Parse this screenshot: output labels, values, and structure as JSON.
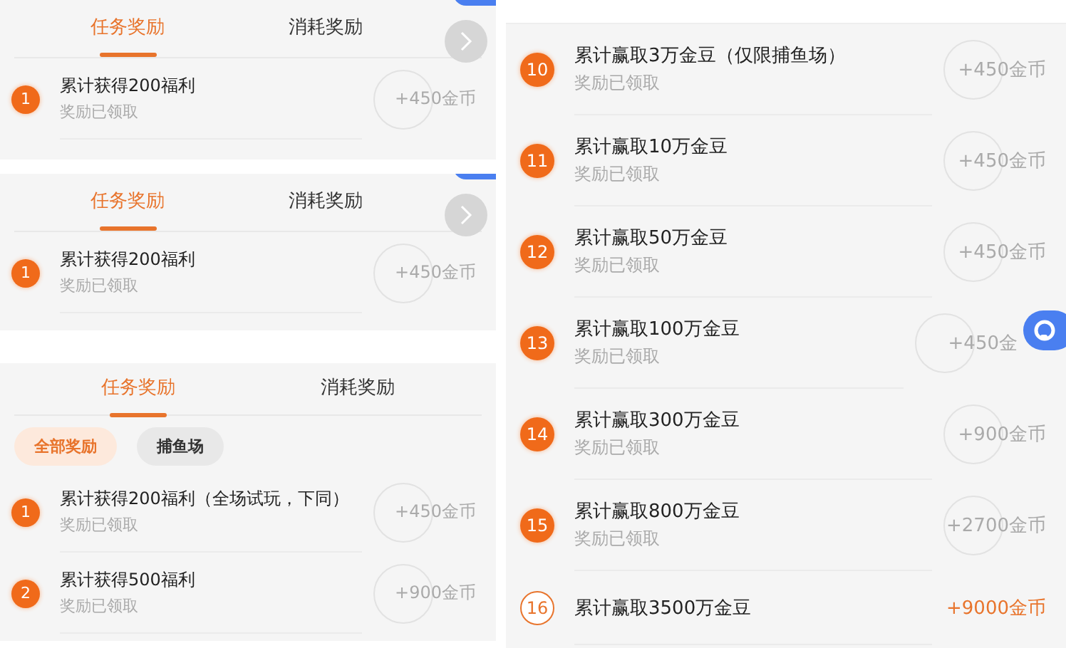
{
  "panels": [
    {
      "arrow_button": true,
      "tabs": [
        {
          "label": "任务奖励",
          "selected": true
        },
        {
          "label": "消耗奖励",
          "selected": false
        }
      ],
      "tasks": [
        {
          "number": "1",
          "title": "累计获得200福利",
          "status": "奖励已领取",
          "reward": "+450金币",
          "claimed": true
        }
      ]
    },
    {
      "arrow_button": true,
      "tabs": [
        {
          "label": "任务奖励",
          "selected": true
        },
        {
          "label": "消耗奖励",
          "selected": false
        }
      ],
      "tasks": [
        {
          "number": "1",
          "title": "累计获得200福利",
          "status": "奖励已领取",
          "reward": "+450金币",
          "claimed": true
        }
      ]
    },
    {
      "arrow_button": false,
      "tabs": [
        {
          "label": "任务奖励",
          "selected": true
        },
        {
          "label": "消耗奖励",
          "selected": false
        }
      ],
      "filters": [
        {
          "label": "全部奖励",
          "selected": true
        },
        {
          "label": "捕鱼场",
          "selected": false
        }
      ],
      "tasks": [
        {
          "number": "1",
          "title": "累计获得200福利（全场试玩，下同）",
          "status": "奖励已领取",
          "reward": "+450金币",
          "claimed": true
        },
        {
          "number": "2",
          "title": "累计获得500福利",
          "status": "奖励已领取",
          "reward": "+900金币",
          "claimed": true
        }
      ]
    }
  ],
  "right_list": {
    "tasks": [
      {
        "number": "10",
        "title": "累计赢取3万金豆（仅限捕鱼场）",
        "status": "奖励已领取",
        "reward": "+450金币",
        "claimed": true
      },
      {
        "number": "11",
        "title": "累计赢取10万金豆",
        "status": "奖励已领取",
        "reward": "+450金币",
        "claimed": true
      },
      {
        "number": "12",
        "title": "累计赢取50万金豆",
        "status": "奖励已领取",
        "reward": "+450金币",
        "claimed": true
      },
      {
        "number": "13",
        "title": "累计赢取100万金豆",
        "status": "奖励已领取",
        "reward": "+450金",
        "claimed": true,
        "support_button": true
      },
      {
        "number": "14",
        "title": "累计赢取300万金豆",
        "status": "奖励已领取",
        "reward": "+900金币",
        "claimed": true
      },
      {
        "number": "15",
        "title": "累计赢取800万金豆",
        "status": "奖励已领取",
        "reward": "+2700金币",
        "claimed": true
      },
      {
        "number": "16",
        "title": "累计赢取3500万金豆",
        "reward": "+9000金币",
        "claimed": false
      }
    ]
  }
}
